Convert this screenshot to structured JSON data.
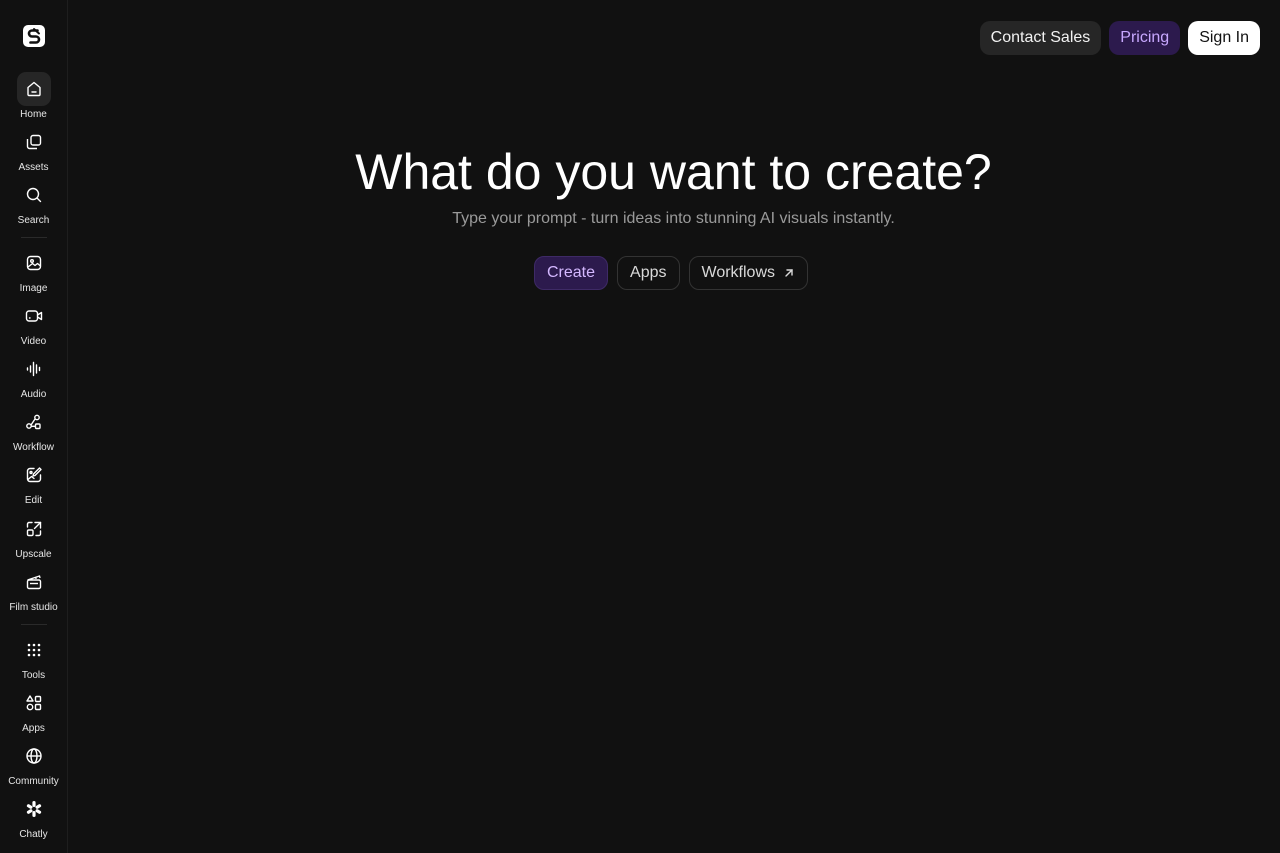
{
  "sidebar": {
    "items": [
      {
        "label": "Home",
        "icon": "home-icon"
      },
      {
        "label": "Assets",
        "icon": "assets-icon"
      },
      {
        "label": "Search",
        "icon": "search-icon"
      },
      {
        "label": "Image",
        "icon": "image-icon"
      },
      {
        "label": "Video",
        "icon": "video-icon"
      },
      {
        "label": "Audio",
        "icon": "audio-icon"
      },
      {
        "label": "Workflow",
        "icon": "workflow-icon"
      },
      {
        "label": "Edit",
        "icon": "edit-icon"
      },
      {
        "label": "Upscale",
        "icon": "upscale-icon"
      },
      {
        "label": "Film studio",
        "icon": "film-studio-icon"
      },
      {
        "label": "Tools",
        "icon": "tools-icon"
      },
      {
        "label": "Apps",
        "icon": "apps-icon"
      },
      {
        "label": "Community",
        "icon": "globe-icon"
      },
      {
        "label": "Chatly",
        "icon": "chatly-icon"
      }
    ]
  },
  "header": {
    "contact_label": "Contact Sales",
    "pricing_label": "Pricing",
    "signin_label": "Sign In"
  },
  "hero": {
    "title": "What do you want to create?",
    "subtitle": "Type your prompt - turn ideas into stunning AI visuals instantly."
  },
  "tabs": [
    {
      "label": "Create",
      "active": true
    },
    {
      "label": "Apps",
      "active": false
    },
    {
      "label": "Workflows",
      "active": false,
      "icon": "arrow-up-right-icon"
    }
  ],
  "colors": {
    "background": "#111111",
    "accent": "#2c1a4d",
    "accent_text": "#c8a8ff"
  }
}
